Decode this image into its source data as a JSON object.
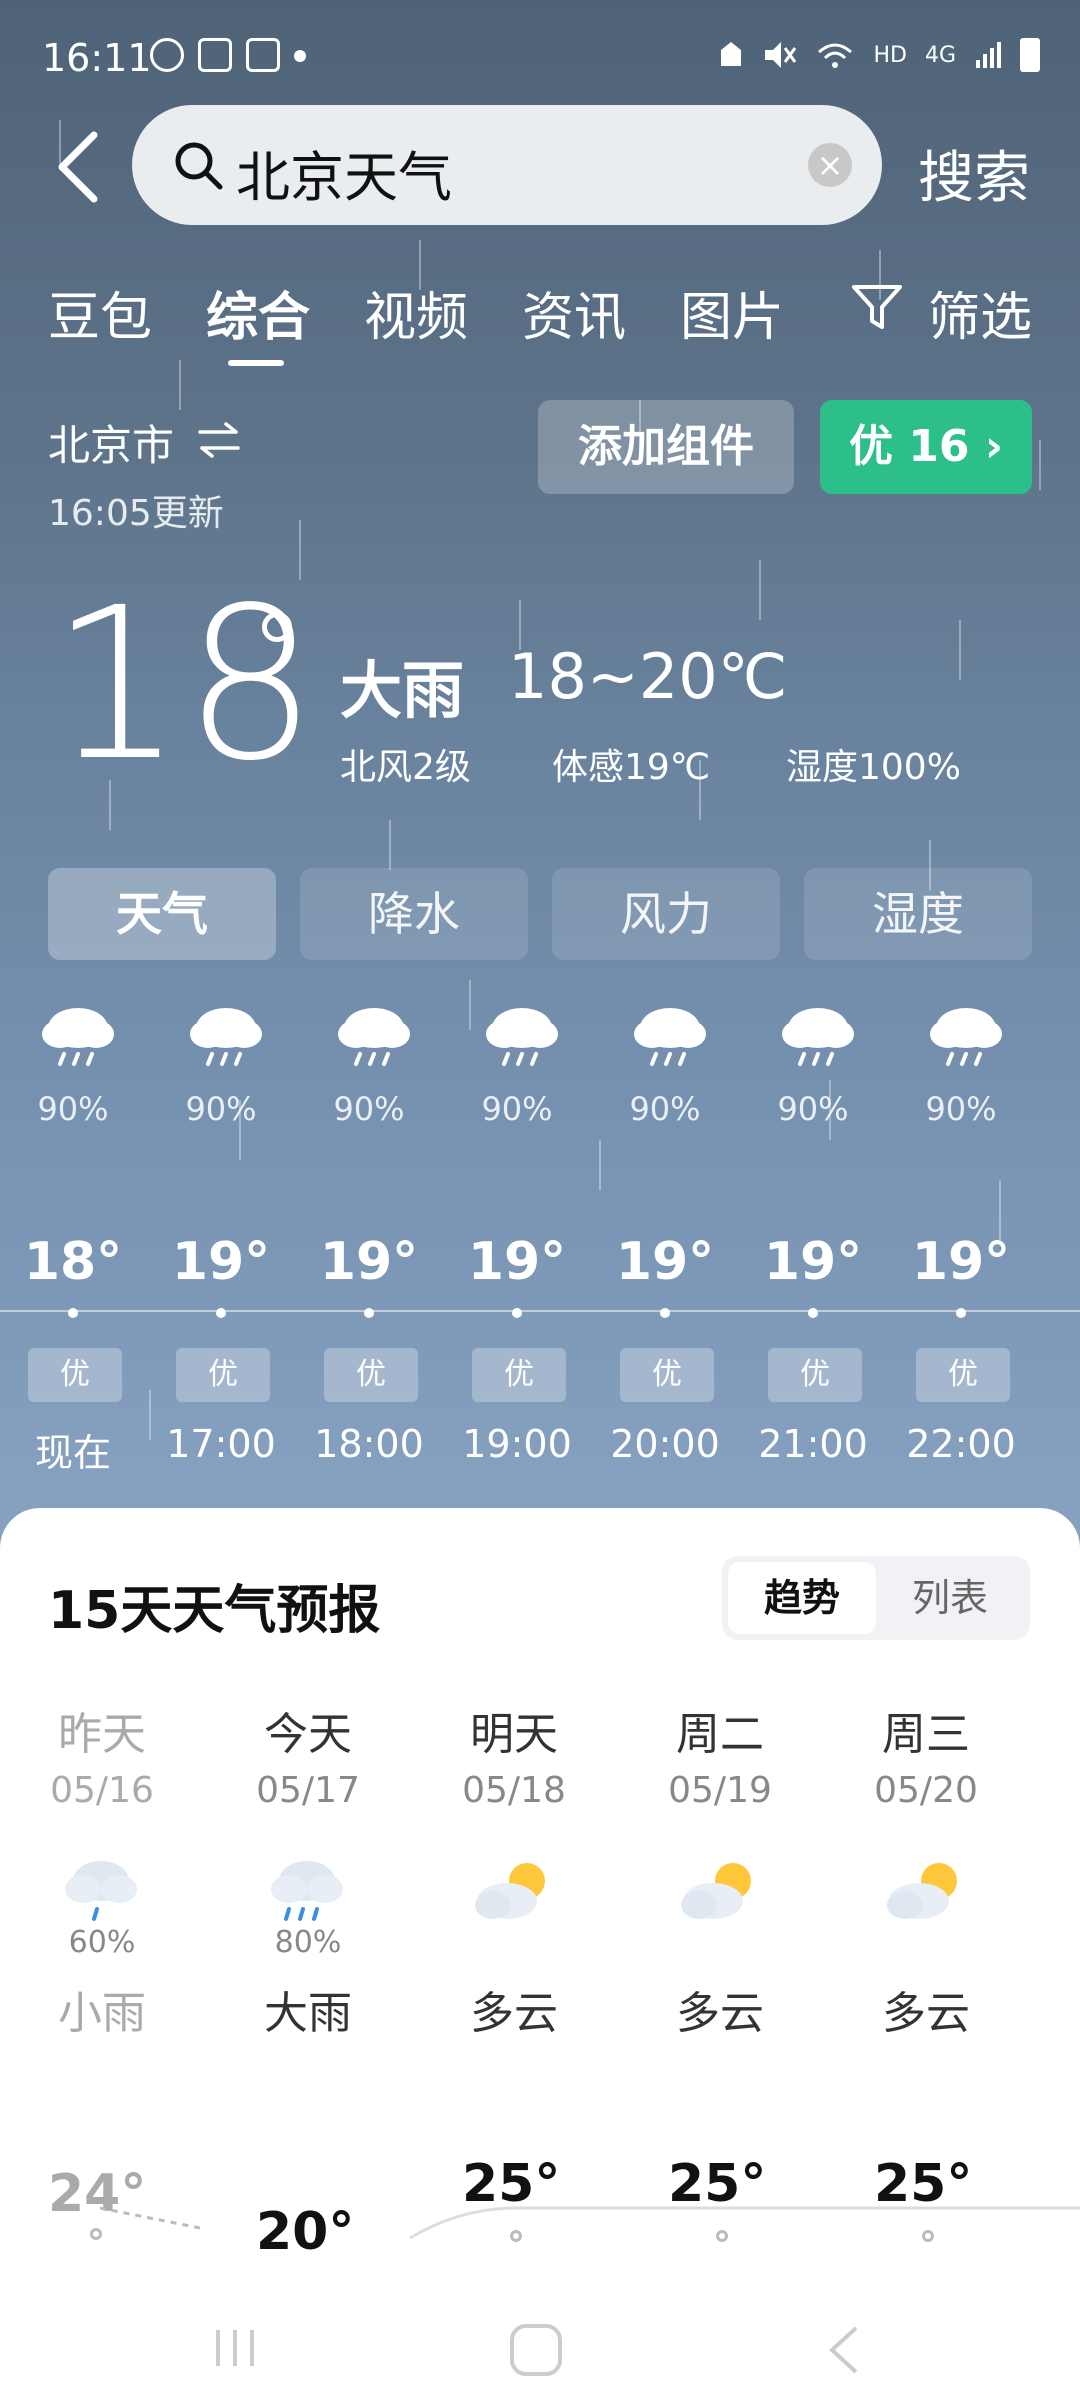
{
  "status_bar": {
    "time": "16:11",
    "network": "HD",
    "signal_label": "4G"
  },
  "search": {
    "query": "北京天气",
    "submit_label": "搜索"
  },
  "tabs": [
    {
      "label": "豆包",
      "active": false
    },
    {
      "label": "综合",
      "active": true
    },
    {
      "label": "视频",
      "active": false
    },
    {
      "label": "资讯",
      "active": false
    },
    {
      "label": "图片",
      "active": false
    },
    {
      "label": "筛选",
      "active": false
    }
  ],
  "weather": {
    "city": "北京市",
    "updated": "16:05更新",
    "add_widget_label": "添加组件",
    "aqi_label": "优 16 ›",
    "current_temp": "18",
    "condition": "大雨",
    "range": "18~20℃",
    "wind": "北风2级",
    "feels_like": "体感19℃",
    "humidity": "湿度100%"
  },
  "segments": [
    {
      "label": "天气",
      "active": true
    },
    {
      "label": "降水",
      "active": false
    },
    {
      "label": "风力",
      "active": false
    },
    {
      "label": "湿度",
      "active": false
    }
  ],
  "hourly": [
    {
      "precip": "90%",
      "temp": "18°",
      "aqi": "优",
      "time": "现在"
    },
    {
      "precip": "90%",
      "temp": "19°",
      "aqi": "优",
      "time": "17:00"
    },
    {
      "precip": "90%",
      "temp": "19°",
      "aqi": "优",
      "time": "18:00"
    },
    {
      "precip": "90%",
      "temp": "19°",
      "aqi": "优",
      "time": "19:00"
    },
    {
      "precip": "90%",
      "temp": "19°",
      "aqi": "优",
      "time": "20:00"
    },
    {
      "precip": "90%",
      "temp": "19°",
      "aqi": "优",
      "time": "21:00"
    },
    {
      "precip": "90%",
      "temp": "19°",
      "aqi": "优",
      "time": "22:00"
    }
  ],
  "forecast": {
    "title": "15天天气预报",
    "toggle": [
      {
        "label": "趋势",
        "active": true
      },
      {
        "label": "列表",
        "active": false
      }
    ],
    "days": [
      {
        "name": "昨天",
        "date": "05/16",
        "prob": "60%",
        "cond": "小雨",
        "high": "24°",
        "icon": "light-rain-icon"
      },
      {
        "name": "今天",
        "date": "05/17",
        "prob": "80%",
        "cond": "大雨",
        "high": "20°",
        "icon": "heavy-rain-icon"
      },
      {
        "name": "明天",
        "date": "05/18",
        "prob": "",
        "cond": "多云",
        "high": "25°",
        "icon": "partly-cloudy-icon"
      },
      {
        "name": "周二",
        "date": "05/19",
        "prob": "",
        "cond": "多云",
        "high": "25°",
        "icon": "partly-cloudy-icon"
      },
      {
        "name": "周三",
        "date": "05/20",
        "prob": "",
        "cond": "多云",
        "high": "25°",
        "icon": "partly-cloudy-icon"
      }
    ]
  },
  "colors": {
    "aqi_good": "#2dbf8a",
    "sky": "#6a84a0"
  }
}
